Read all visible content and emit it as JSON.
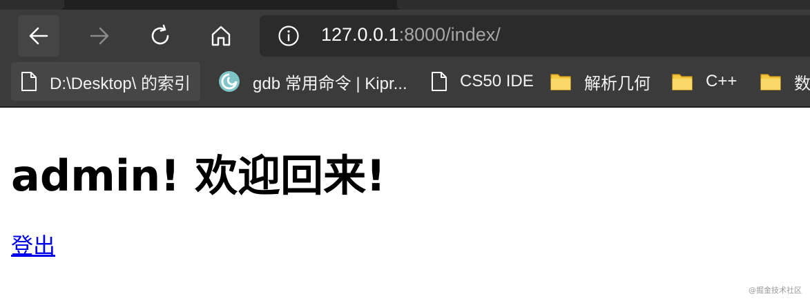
{
  "browser": {
    "address_bar": {
      "host": "127.0.0.1",
      "rest": ":8000/index/"
    },
    "bookmarks": [
      {
        "label": "D:\\Desktop\\ 的索引",
        "icon": "file-icon"
      },
      {
        "label": "gdb 常用命令 | Kipr...",
        "icon": "site-favicon-icon"
      },
      {
        "label": "CS50 IDE",
        "icon": "file-icon"
      },
      {
        "label": "解析几何",
        "icon": "folder-icon"
      },
      {
        "label": "C++",
        "icon": "folder-icon"
      },
      {
        "label": "数",
        "icon": "folder-icon"
      }
    ]
  },
  "page": {
    "heading": "admin! 欢迎回来!",
    "logout_link": "登出"
  },
  "watermark": "@掘金技术社区",
  "colors": {
    "toolbar_bg": "#3b3b3b",
    "address_bg": "#2b2b2b",
    "link": "#0000ee",
    "folder": "#f4c93f"
  }
}
